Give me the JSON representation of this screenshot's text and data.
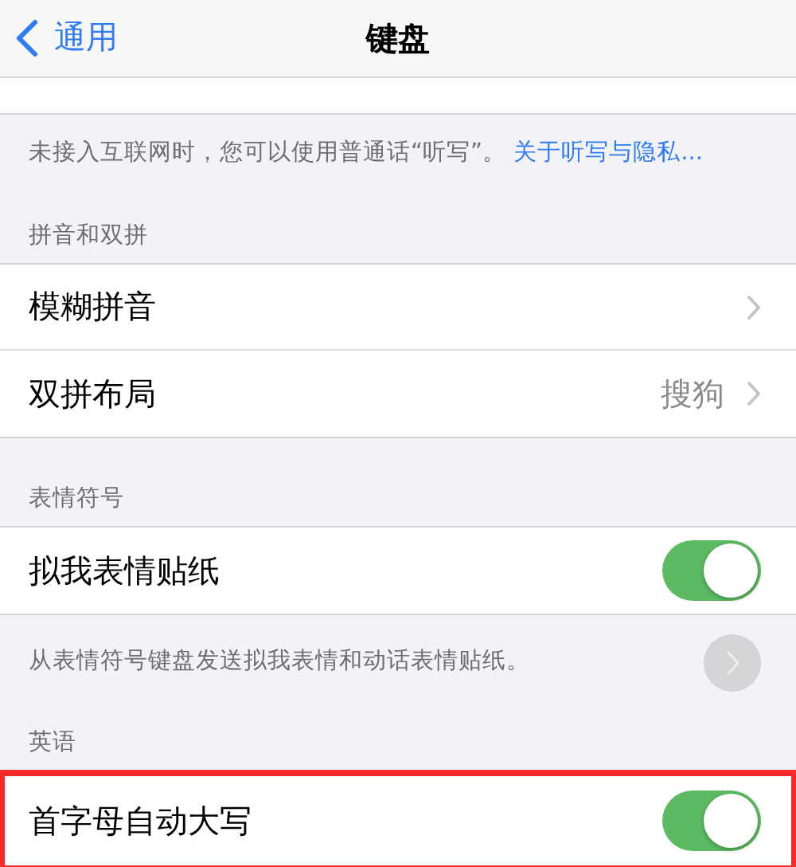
{
  "nav": {
    "back": "通用",
    "title": "键盘"
  },
  "sections": [
    {
      "kind": "cut",
      "footer": "未接入互联网时，您可以使用普通话“听写”。",
      "footer_link": "关于听写与隐私..."
    },
    {
      "kind": "group",
      "header": "拼音和双拼",
      "rows": [
        {
          "kind": "link",
          "label": "模糊拼音"
        },
        {
          "kind": "link",
          "label": "双拼布局",
          "value": "搜狗"
        }
      ]
    },
    {
      "kind": "group",
      "header": "表情符号",
      "rows": [
        {
          "kind": "toggle",
          "label": "拟我表情贴纸",
          "on": true,
          "highlighted": false
        }
      ],
      "footer": "从表情符号键盘发送拟我表情和动话表情贴纸。",
      "floating_button": true
    },
    {
      "kind": "group",
      "header": "英语",
      "rows": [
        {
          "kind": "toggle",
          "label": "首字母自动大写",
          "on": true,
          "highlighted": true
        }
      ]
    }
  ]
}
